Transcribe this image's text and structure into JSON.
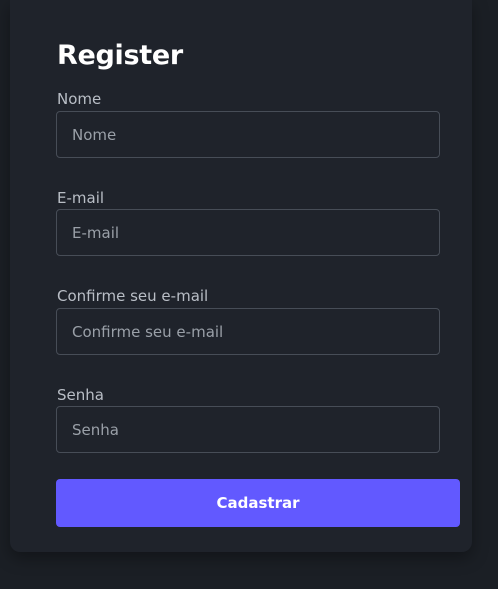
{
  "form": {
    "title": "Register",
    "fields": [
      {
        "label": "Nome",
        "placeholder": "Nome",
        "value": ""
      },
      {
        "label": "E-mail",
        "placeholder": "E-mail",
        "value": ""
      },
      {
        "label": "Confirme seu e-mail",
        "placeholder": "Confirme seu e-mail",
        "value": ""
      },
      {
        "label": "Senha",
        "placeholder": "Senha",
        "value": ""
      }
    ],
    "submit_label": "Cadastrar"
  },
  "colors": {
    "background": "#1b1f25",
    "card": "#1f232b",
    "accent": "#6259ff",
    "input_border": "#474d57"
  }
}
